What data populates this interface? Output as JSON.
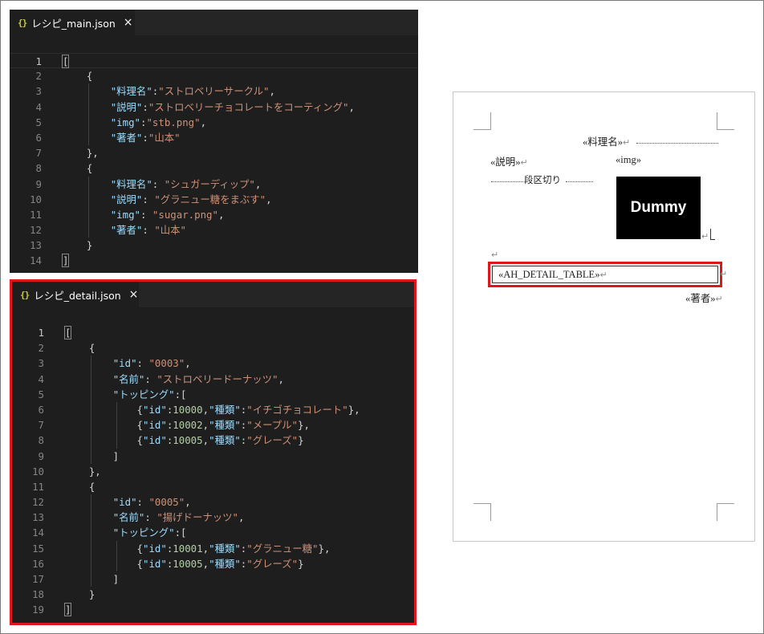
{
  "editor_main": {
    "tab_icon": "{}",
    "tab_name": "レシピ_main.json",
    "close_glyph": "×",
    "line_numbers": [
      "1",
      "2",
      "3",
      "4",
      "5",
      "6",
      "7",
      "8",
      "9",
      "10",
      "11",
      "12",
      "13",
      "14"
    ],
    "lines": [
      [
        [
          "p",
          "["
        ]
      ],
      [
        [
          "p",
          "    {"
        ]
      ],
      [
        [
          "p",
          "        "
        ],
        [
          "k",
          "\"料理名\""
        ],
        [
          "p",
          ":"
        ],
        [
          "s",
          "\"ストロベリーサークル\""
        ],
        [
          "p",
          ","
        ]
      ],
      [
        [
          "p",
          "        "
        ],
        [
          "k",
          "\"説明\""
        ],
        [
          "p",
          ":"
        ],
        [
          "s",
          "\"ストロベリーチョコレートをコーティング\""
        ],
        [
          "p",
          ","
        ]
      ],
      [
        [
          "p",
          "        "
        ],
        [
          "k",
          "\"img\""
        ],
        [
          "p",
          ":"
        ],
        [
          "s",
          "\"stb.png\""
        ],
        [
          "p",
          ","
        ]
      ],
      [
        [
          "p",
          "        "
        ],
        [
          "k",
          "\"著者\""
        ],
        [
          "p",
          ":"
        ],
        [
          "s",
          "\"山本\""
        ]
      ],
      [
        [
          "p",
          "    },"
        ]
      ],
      [
        [
          "p",
          "    {"
        ]
      ],
      [
        [
          "p",
          "        "
        ],
        [
          "k",
          "\"料理名\""
        ],
        [
          "p",
          ": "
        ],
        [
          "s",
          "\"シュガーディップ\""
        ],
        [
          "p",
          ","
        ]
      ],
      [
        [
          "p",
          "        "
        ],
        [
          "k",
          "\"説明\""
        ],
        [
          "p",
          ": "
        ],
        [
          "s",
          "\"グラニュー糖をまぶす\""
        ],
        [
          "p",
          ","
        ]
      ],
      [
        [
          "p",
          "        "
        ],
        [
          "k",
          "\"img\""
        ],
        [
          "p",
          ": "
        ],
        [
          "s",
          "\"sugar.png\""
        ],
        [
          "p",
          ","
        ]
      ],
      [
        [
          "p",
          "        "
        ],
        [
          "k",
          "\"著者\""
        ],
        [
          "p",
          ": "
        ],
        [
          "s",
          "\"山本\""
        ]
      ],
      [
        [
          "p",
          "    }"
        ]
      ],
      [
        [
          "p",
          "]"
        ]
      ]
    ]
  },
  "editor_detail": {
    "tab_icon": "{}",
    "tab_name": "レシピ_detail.json",
    "close_glyph": "×",
    "line_numbers": [
      "1",
      "2",
      "3",
      "4",
      "5",
      "6",
      "7",
      "8",
      "9",
      "10",
      "11",
      "12",
      "13",
      "14",
      "15",
      "16",
      "17",
      "18",
      "19"
    ],
    "lines": [
      [
        [
          "p",
          "["
        ]
      ],
      [
        [
          "p",
          "    {"
        ]
      ],
      [
        [
          "p",
          "        "
        ],
        [
          "k",
          "\"id\""
        ],
        [
          "p",
          ": "
        ],
        [
          "s",
          "\"0003\""
        ],
        [
          "p",
          ","
        ]
      ],
      [
        [
          "p",
          "        "
        ],
        [
          "k",
          "\"名前\""
        ],
        [
          "p",
          ": "
        ],
        [
          "s",
          "\"ストロベリードーナッツ\""
        ],
        [
          "p",
          ","
        ]
      ],
      [
        [
          "p",
          "        "
        ],
        [
          "k",
          "\"トッピング\""
        ],
        [
          "p",
          ":["
        ]
      ],
      [
        [
          "p",
          "            {"
        ],
        [
          "k",
          "\"id\""
        ],
        [
          "p",
          ":"
        ],
        [
          "n",
          "10000"
        ],
        [
          "p",
          ","
        ],
        [
          "k",
          "\"種類\""
        ],
        [
          "p",
          ":"
        ],
        [
          "s",
          "\"イチゴチョコレート\""
        ],
        [
          "p",
          "},"
        ]
      ],
      [
        [
          "p",
          "            {"
        ],
        [
          "k",
          "\"id\""
        ],
        [
          "p",
          ":"
        ],
        [
          "n",
          "10002"
        ],
        [
          "p",
          ","
        ],
        [
          "k",
          "\"種類\""
        ],
        [
          "p",
          ":"
        ],
        [
          "s",
          "\"メープル\""
        ],
        [
          "p",
          "},"
        ]
      ],
      [
        [
          "p",
          "            {"
        ],
        [
          "k",
          "\"id\""
        ],
        [
          "p",
          ":"
        ],
        [
          "n",
          "10005"
        ],
        [
          "p",
          ","
        ],
        [
          "k",
          "\"種類\""
        ],
        [
          "p",
          ":"
        ],
        [
          "s",
          "\"グレーズ\""
        ],
        [
          "p",
          "}"
        ]
      ],
      [
        [
          "p",
          "        ]"
        ]
      ],
      [
        [
          "p",
          "    },"
        ]
      ],
      [
        [
          "p",
          "    {"
        ]
      ],
      [
        [
          "p",
          "        "
        ],
        [
          "k",
          "\"id\""
        ],
        [
          "p",
          ": "
        ],
        [
          "s",
          "\"0005\""
        ],
        [
          "p",
          ","
        ]
      ],
      [
        [
          "p",
          "        "
        ],
        [
          "k",
          "\"名前\""
        ],
        [
          "p",
          ": "
        ],
        [
          "s",
          "\"揚げドーナッツ\""
        ],
        [
          "p",
          ","
        ]
      ],
      [
        [
          "p",
          "        "
        ],
        [
          "k",
          "\"トッピング\""
        ],
        [
          "p",
          ":["
        ]
      ],
      [
        [
          "p",
          "            {"
        ],
        [
          "k",
          "\"id\""
        ],
        [
          "p",
          ":"
        ],
        [
          "n",
          "10001"
        ],
        [
          "p",
          ","
        ],
        [
          "k",
          "\"種類\""
        ],
        [
          "p",
          ":"
        ],
        [
          "s",
          "\"グラニュー糖\""
        ],
        [
          "p",
          "},"
        ]
      ],
      [
        [
          "p",
          "            {"
        ],
        [
          "k",
          "\"id\""
        ],
        [
          "p",
          ":"
        ],
        [
          "n",
          "10005"
        ],
        [
          "p",
          ","
        ],
        [
          "k",
          "\"種類\""
        ],
        [
          "p",
          ":"
        ],
        [
          "s",
          "\"グレーズ\""
        ],
        [
          "p",
          "}"
        ]
      ],
      [
        [
          "p",
          "        ]"
        ]
      ],
      [
        [
          "p",
          "    }"
        ]
      ],
      [
        [
          "p",
          "]"
        ]
      ]
    ]
  },
  "template_page": {
    "field_name": "«料理名»",
    "field_description": "«説明»",
    "field_img": "«img»",
    "column_break": "段区切り",
    "dummy_label": "Dummy",
    "detail_table": "«AH_DETAIL_TABLE»",
    "field_author": "«著者»",
    "return_mark": "↵"
  },
  "colors": {
    "editor_bg": "#1e1e1e",
    "key": "#9cdcfe",
    "string": "#ce9178",
    "number": "#b5cea8",
    "highlight": "#e0161b"
  }
}
